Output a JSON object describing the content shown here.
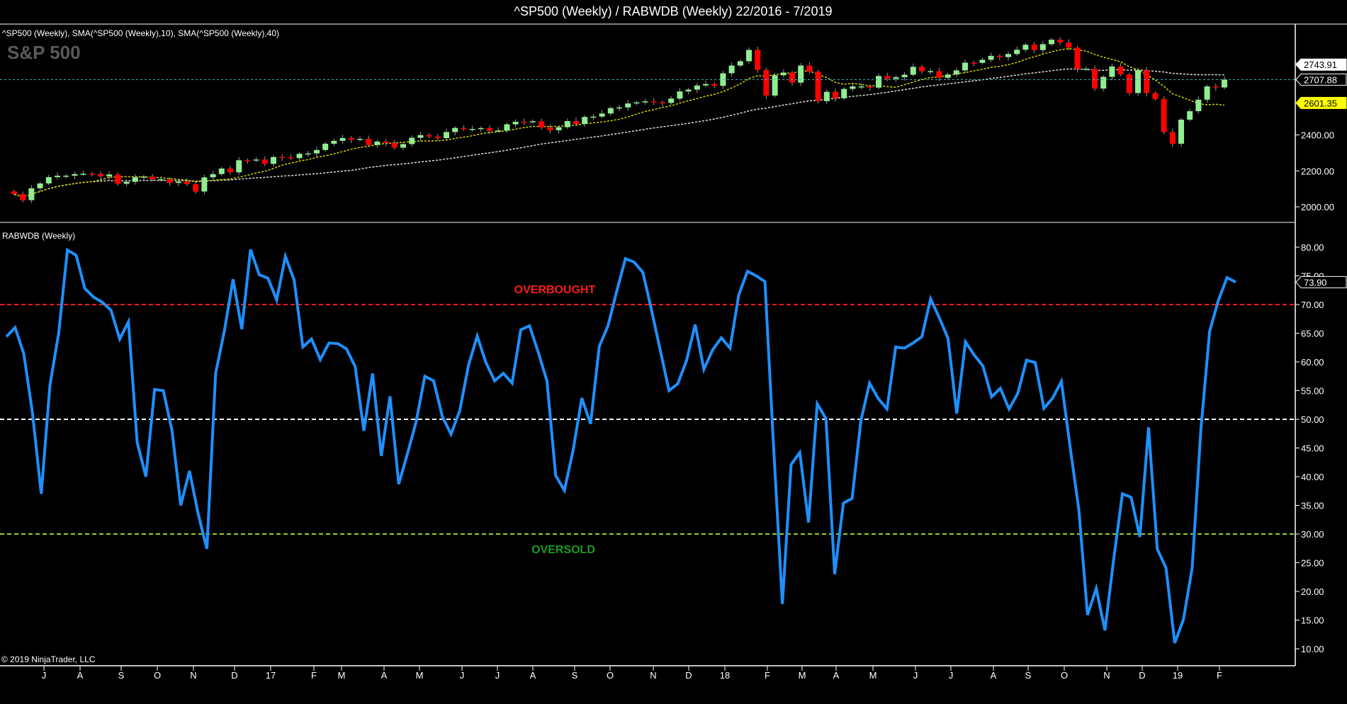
{
  "title": "^SP500 (Weekly) / RABWDB (Weekly)  22/2016 - 7/2019",
  "copyright": "© 2019 NinjaTrader, LLC",
  "colors": {
    "background": "#000000",
    "up_candle": "#90ee90",
    "down_candle": "#ff0000",
    "sma10": "#d4d400",
    "sma40": "#e0e0e0",
    "rabwdb_line": "#1e90ff",
    "overbought": "#ff1a1a",
    "oversold": "#1e9a1e",
    "midline": "#ffffff",
    "oversold_line": "#9acd32",
    "last_price_line": "#3cc0c0"
  },
  "chart_data": [
    {
      "type": "candlestick",
      "legend": "^SP500 (Weekly),  SMA(^SP500 (Weekly),10),  SMA(^SP500 (Weekly),40)",
      "watermark": "S&P 500",
      "ylim": [
        1900,
        3050
      ],
      "yticks": [
        "2000.00",
        "2200.00",
        "2400.00",
        "2800.00"
      ],
      "ytick_values": [
        2000,
        2200,
        2400,
        2800
      ],
      "closes": [
        2071,
        2037,
        2103,
        2130,
        2165,
        2173,
        2173,
        2182,
        2184,
        2183,
        2169,
        2180,
        2128,
        2139,
        2164,
        2168,
        2153,
        2153,
        2133,
        2141,
        2126,
        2085,
        2164,
        2182,
        2213,
        2192,
        2259,
        2258,
        2263,
        2239,
        2277,
        2275,
        2271,
        2295,
        2297,
        2316,
        2351,
        2367,
        2383,
        2373,
        2378,
        2344,
        2363,
        2355,
        2329,
        2349,
        2384,
        2399,
        2391,
        2382,
        2416,
        2439,
        2432,
        2433,
        2438,
        2423,
        2425,
        2459,
        2473,
        2472,
        2476,
        2441,
        2426,
        2443,
        2477,
        2461,
        2500,
        2502,
        2519,
        2549,
        2553,
        2575,
        2581,
        2587,
        2582,
        2578,
        2602,
        2642,
        2652,
        2675,
        2683,
        2673,
        2743,
        2786,
        2810,
        2873,
        2762,
        2619,
        2732,
        2747,
        2691,
        2786,
        2752,
        2588,
        2640,
        2604,
        2656,
        2670,
        2670,
        2663,
        2728,
        2712,
        2721,
        2735,
        2779,
        2754,
        2755,
        2718,
        2736,
        2759,
        2802,
        2801,
        2818,
        2840,
        2833,
        2850,
        2874,
        2902,
        2872,
        2905,
        2930,
        2914,
        2886,
        2767,
        2768,
        2658,
        2723,
        2781,
        2736,
        2633,
        2760,
        2633,
        2600,
        2416,
        2351,
        2485,
        2532,
        2596,
        2670,
        2664,
        2707.88
      ],
      "sma_periods": [
        10,
        40
      ],
      "price_labels": {
        "sma40": "2743.91",
        "last": "2707.88",
        "sma10": "2601.35"
      }
    },
    {
      "type": "line",
      "legend": "RABWDB (Weekly)",
      "ylim": [
        7,
        83
      ],
      "yticks": [
        "10.00",
        "15.00",
        "20.00",
        "25.00",
        "30.00",
        "35.00",
        "40.00",
        "45.00",
        "50.00",
        "55.00",
        "60.00",
        "65.00",
        "70.00",
        "75.00",
        "80.00"
      ],
      "ytick_values": [
        10,
        15,
        20,
        25,
        30,
        35,
        40,
        45,
        50,
        55,
        60,
        65,
        70,
        75,
        80
      ],
      "values": [
        64.4,
        66,
        61.4,
        51,
        37,
        56,
        65,
        79.5,
        78.6,
        72.8,
        71.3,
        70.4,
        69,
        64,
        67,
        46,
        40,
        55.2,
        55,
        48,
        35,
        41,
        33.5,
        27.4,
        58,
        65.4,
        74.4,
        65.7,
        79.6,
        75.2,
        74.6,
        70.8,
        78.4,
        74.3,
        62.6,
        64,
        60.4,
        63.3,
        63.2,
        62.3,
        59.2,
        48,
        58,
        43.6,
        54,
        38.7,
        44,
        49.6,
        57.5,
        56.7,
        50.5,
        47.4,
        51.5,
        59.4,
        64.5,
        59.9,
        56.7,
        58,
        56.3,
        65.6,
        66.3,
        61.7,
        56.7,
        40.2,
        37.6,
        44.6,
        53.7,
        49.2,
        62.7,
        66.3,
        72.3,
        78,
        77.4,
        75.6,
        69,
        62,
        55,
        56.2,
        60.2,
        66.5,
        58.7,
        62.1,
        64.2,
        62.4,
        71.7,
        75.8,
        75,
        74,
        45,
        17.8,
        42.1,
        44.2,
        32,
        52.7,
        50.1,
        23,
        35.4,
        36.2,
        49.7,
        56.3,
        53.6,
        51.8,
        62.6,
        62.4,
        63.3,
        64.4,
        71,
        67.7,
        64.1,
        51,
        63.5,
        61.2,
        59.3,
        53.9,
        55.4,
        51.8,
        54.5,
        60.3,
        59.9,
        51.9,
        53.7,
        56.6,
        45.2,
        34.3,
        15.9,
        20.5,
        13.2,
        25.6,
        37,
        36.4,
        29.5,
        48.6,
        27.4,
        24.1,
        11,
        15.1,
        24.1,
        48.2,
        65.3,
        70.7,
        74.7,
        73.9
      ],
      "last_label": "73.90",
      "levels": [
        {
          "value": 70,
          "label": "OVERBOUGHT"
        },
        {
          "value": 50,
          "label": ""
        },
        {
          "value": 30,
          "label": "OVERSOLD"
        }
      ]
    }
  ],
  "xaxis": {
    "ticks": [
      "J",
      "A",
      "S",
      "O",
      "N",
      "D",
      "17",
      "F",
      "M",
      "A",
      "M",
      "J",
      "J",
      "A",
      "S",
      "O",
      "N",
      "D",
      "18",
      "F",
      "M",
      "A",
      "M",
      "J",
      "J",
      "A",
      "S",
      "O",
      "N",
      "D",
      "19",
      "F"
    ]
  }
}
